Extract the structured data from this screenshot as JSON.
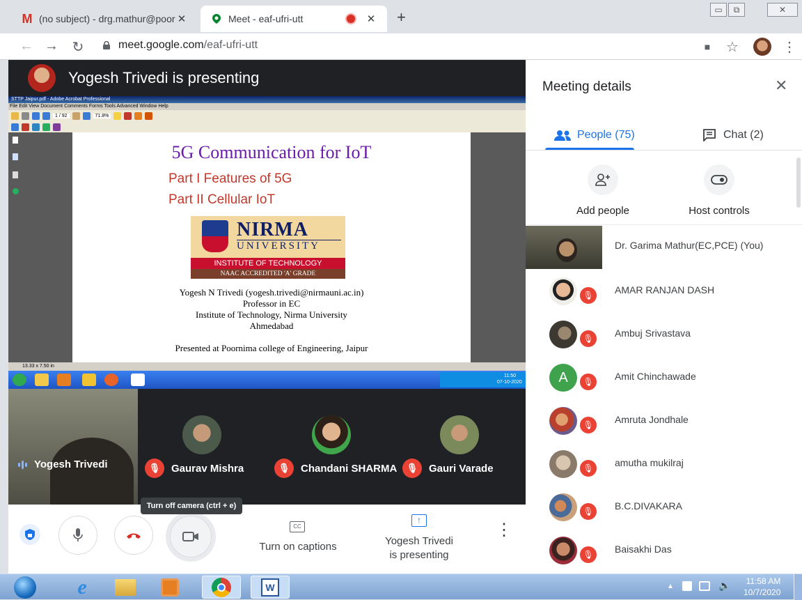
{
  "browser": {
    "tabs": [
      {
        "title": "(no subject) - drg.mathur@poorr",
        "icon": "gmail-icon"
      },
      {
        "title": "Meet - eaf-ufri-utt",
        "icon": "meet-icon",
        "recording": true
      }
    ],
    "url_host": "meet.google.com",
    "url_path": "/eaf-ufri-utt"
  },
  "stage": {
    "presenting_banner": "Yogesh Trivedi is presenting",
    "acrobat": {
      "window_title": "STTP Jaipur.pdf - Adobe Acrobat Professional",
      "menu": "File  Edit  View  Document  Comments  Forms  Tools  Advanced  Window  Help",
      "page_status": "13.33 x 7.50 in",
      "zoom": "71.8%",
      "page": "1 / 92",
      "tray_time": "11:50",
      "tray_date": "07-10-2020"
    },
    "slide": {
      "title": "5G Communication for IoT",
      "part1": "Part I Features of 5G",
      "part2": "Part II Cellular IoT",
      "logo_name": "NIRMA",
      "logo_univ": "UNIVERSITY",
      "logo_inst": "INSTITUTE OF TECHNOLOGY",
      "logo_naac": "NAAC ACCREDITED 'A' GRADE",
      "author": "Yogesh N Trivedi (yogesh.trivedi@nirmauni.ac.in)",
      "role": "Professor in EC",
      "institute": "Institute of Technology, Nirma University",
      "city": "Ahmedabad",
      "presented_at": "Presented at Poornima college of Engineering, Jaipur"
    },
    "tiles": [
      {
        "name": "Yogesh Trivedi",
        "state": "speaking"
      },
      {
        "name": "Gaurav Mishra",
        "state": "muted"
      },
      {
        "name": "Chandani SHARMA",
        "state": "muted"
      },
      {
        "name": "Gauri Varade",
        "state": "muted"
      }
    ],
    "tooltip": "Turn off camera (ctrl + e)",
    "controls": {
      "captions": "Turn on captions",
      "presenting_line1": "Yogesh Trivedi",
      "presenting_line2": "is presenting"
    }
  },
  "panel": {
    "title": "Meeting details",
    "tab_people": "People (75)",
    "tab_chat": "Chat (2)",
    "add_people": "Add people",
    "host_controls": "Host controls",
    "participants": [
      {
        "name": "Dr. Garima Mathur(EC,PCE) (You)",
        "avatar": "video",
        "muted": false
      },
      {
        "name": "AMAR RANJAN DASH",
        "avatar": "photo",
        "muted": true
      },
      {
        "name": "Ambuj Srivastava",
        "avatar": "photo",
        "muted": true
      },
      {
        "name": "Amit Chinchawade",
        "avatar": "letter",
        "letter": "A",
        "muted": true
      },
      {
        "name": "Amruta Jondhale",
        "avatar": "photo",
        "muted": true
      },
      {
        "name": "amutha mukilraj",
        "avatar": "photo",
        "muted": true
      },
      {
        "name": "B.C.DIVAKARA",
        "avatar": "photo",
        "muted": true
      },
      {
        "name": "Baisakhi Das",
        "avatar": "photo",
        "muted": true
      }
    ]
  },
  "taskbar": {
    "time": "11:58 AM",
    "date": "10/7/2020"
  },
  "colors": {
    "meet_blue": "#1a73e8",
    "mute_red": "#ea4335",
    "stage_bg": "#202124"
  }
}
